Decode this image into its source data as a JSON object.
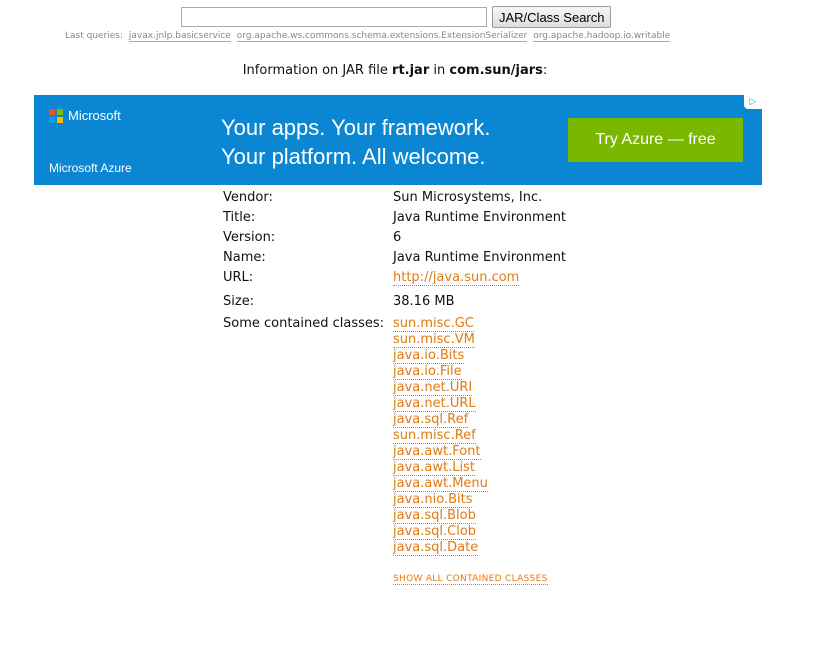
{
  "search": {
    "input_value": "",
    "button_label": "JAR/Class Search"
  },
  "last_queries": {
    "label": "Last queries:",
    "items": [
      "javax.jnlp.basicservice",
      "org.apache.ws.commons.schema.extensions.ExtensionSerializer",
      "org.apache.hadoop.io.writable"
    ]
  },
  "heading": {
    "prefix": "Information on JAR file",
    "jar_name": "rt.jar",
    "middle": "in",
    "location": "com.sun/jars",
    "suffix": ":"
  },
  "ad": {
    "brand": "Microsoft",
    "product": "Microsoft Azure",
    "tagline_line1": "Your apps. Your framework.",
    "tagline_line2": "Your platform. All welcome.",
    "cta": "Try Azure — free",
    "adchoices_icon": "adchoices-icon",
    "colors": {
      "background": "#0b86d3",
      "cta": "#7ab800",
      "logo": [
        "#f25022",
        "#7fba00",
        "#00a4ef",
        "#ffb900"
      ]
    }
  },
  "info": {
    "vendor_label": "Vendor:",
    "vendor": "Sun Microsystems, Inc.",
    "title_label": "Title:",
    "title": "Java Runtime Environment",
    "version_label": "Version:",
    "version": "6",
    "name_label": "Name:",
    "name": "Java Runtime Environment",
    "url_label": "URL:",
    "url": "http://java.sun.com",
    "size_label": "Size:",
    "size": "38.16 MB",
    "classes_label": "Some contained classes:",
    "classes": [
      "sun.misc.GC",
      "sun.misc.VM",
      "java.io.Bits",
      "java.io.File",
      "java.net.URI",
      "java.net.URL",
      "java.sql.Ref",
      "sun.misc.Ref",
      "java.awt.Font",
      "java.awt.List",
      "java.awt.Menu",
      "java.nio.Bits",
      "java.sql.Blob",
      "java.sql.Clob",
      "java.sql.Date"
    ],
    "show_all": "SHOW ALL CONTAINED CLASSES"
  },
  "colors": {
    "link": "#e07b14",
    "muted": "#888888"
  }
}
